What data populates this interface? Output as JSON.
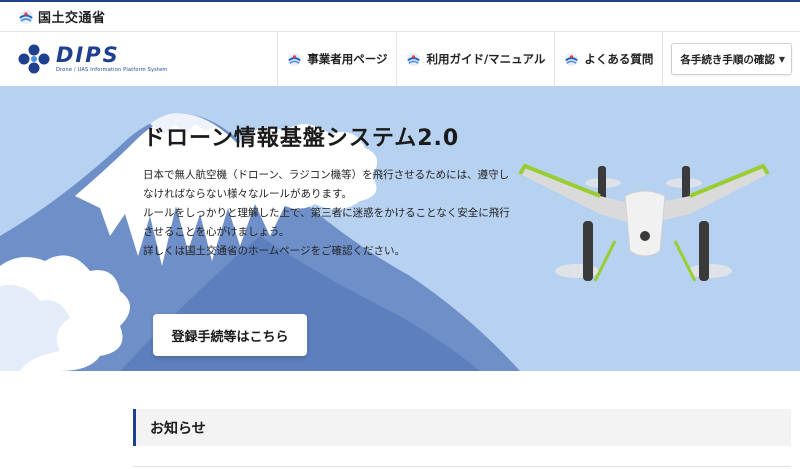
{
  "ministry": {
    "name": "国土交通省",
    "icon": "mlit-logo-icon"
  },
  "logo": {
    "text": "DIPS",
    "subtitle": "Drone / UAS Information Platform System"
  },
  "nav": {
    "items": [
      {
        "label": "事業者用ページ",
        "icon": "mlit-logo-icon"
      },
      {
        "label": "利用ガイド/マニュアル",
        "icon": "mlit-logo-icon"
      },
      {
        "label": "よくある質問",
        "icon": "mlit-logo-icon"
      }
    ],
    "dropdown": {
      "label": "各手続き手順の確認",
      "icon": "chevron-down-icon"
    }
  },
  "hero": {
    "title": "ドローン情報基盤システム2.0",
    "description": [
      "日本で無人航空機（ドローン、ラジコン機等）を飛行させるためには、遵守し",
      "なければならない様々なルールがあります。",
      "ルールをしっかりと理解した上で、第三者に迷惑をかけることなく安全に飛行",
      "させることを心がけましょう。",
      "詳しくは国土交通省のホームページをご確認ください。"
    ],
    "cta_label": "登録手続等はこちら"
  },
  "notice": {
    "heading": "お知らせ"
  },
  "colors": {
    "brand": "#1f3f8f",
    "hero_bg": "#b7d1f1",
    "mountain": "#6f8fc9",
    "drone_accent": "#9acd32"
  }
}
